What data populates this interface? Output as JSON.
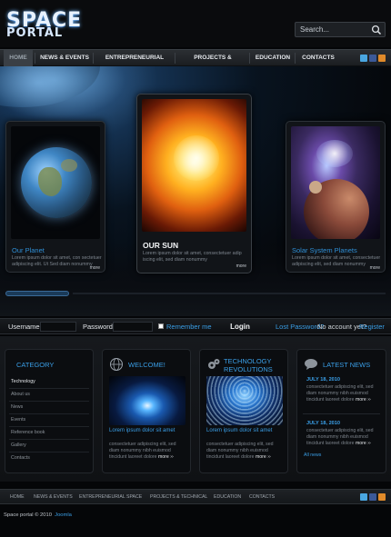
{
  "header": {
    "logo_line1": "SPACE",
    "logo_line2": "PORTAL",
    "search_placeholder": "Search..."
  },
  "nav": {
    "items": [
      "HOME",
      "NEWS & EVENTS",
      "ENTREPRENEURIAL SPACE",
      "PROJECTS & TECHNICAL",
      "EDUCATION",
      "CONTACTS"
    ],
    "social": [
      "twitter-icon",
      "facebook-icon",
      "rss-icon"
    ]
  },
  "hero": {
    "cards": [
      {
        "title": "Our Planet",
        "text": "Lorem ipsum dolor sit amet, con sectetuer adipiscing elit. Ut Sed diam nonummy",
        "more": "more"
      },
      {
        "title": "OUR SUN",
        "text": "Lorem ipsum dolor sit amet, consectetuer adip iscing elit, sed diam nonummy",
        "more": "more"
      },
      {
        "title": "Solar System Planets",
        "text": "Lorem ipsum dolor sit amet, consectetuer adipiscing elit, sed diam nonummy",
        "more": "more"
      }
    ]
  },
  "login": {
    "username_label": "Username:",
    "password_label": "Password",
    "remember_label": "Remember me",
    "login_button": "Login",
    "lost_password": "Lost Password?",
    "no_account": "No account yet?",
    "register": "Register"
  },
  "category": {
    "title": "CATEGORY",
    "items": [
      "Technology",
      "About us",
      "News",
      "Events",
      "Reference book",
      "Gallery",
      "Contacts"
    ]
  },
  "welcome": {
    "title": "WELCOME!",
    "headline": "Lorem ipsum dolor sit amet",
    "text": "consectetuer adipiscing elit, sed diam nonummy nibh euismod tincidunt laoreet dolore",
    "more": "more"
  },
  "technology": {
    "title_line1": "TECHNOLOGY",
    "title_line2": "REVOLUTIONS",
    "headline": "Lorem ipsum dolor sit amet",
    "text": "consectetuer adipiscing elit, sed diam nonummy nibh euismod tincidunt laoreet dolore",
    "more": "more"
  },
  "news": {
    "title": "LATEST NEWS",
    "items": [
      {
        "date": "JULY 18, 2010",
        "text": "consectetuer adipiscing elit, sed diam nonummy nibh euismod tincidunt laoreet dolore",
        "more": "more"
      },
      {
        "date": "JULY 18, 2010",
        "text": "consectetuer adipiscing elit, sed diam nonummy nibh euismod tincidunt laoreet dolore",
        "more": "more"
      }
    ],
    "all_news": "All news"
  },
  "footer": {
    "nav": [
      "HOME",
      "NEWS & EVENTS",
      "ENTREPRENEURIAL SPACE",
      "PROJECTS & TECHNICAL",
      "EDUCATION",
      "CONTACTS"
    ],
    "copyright": "Space portal © 2010",
    "powered": "Joomla"
  },
  "colors": {
    "accent": "#3a9ee6",
    "background": "#050608"
  }
}
